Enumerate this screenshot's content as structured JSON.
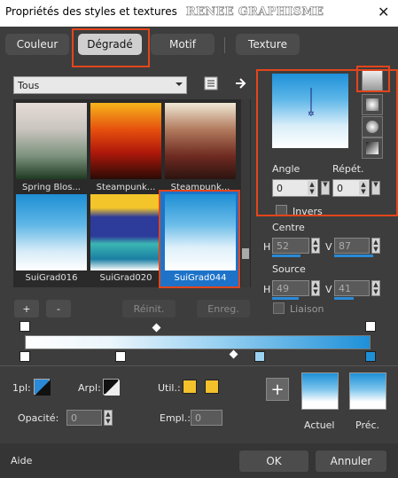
{
  "window": {
    "title": "Propriétés des styles et textures",
    "watermark": "RENEE GRAPHISME",
    "close": "✕"
  },
  "tabs": [
    {
      "label": "Couleur",
      "active": false
    },
    {
      "label": "Dégradé",
      "active": true
    },
    {
      "label": "Motif",
      "active": false
    },
    {
      "label": "Texture",
      "active": false
    }
  ],
  "category": {
    "selected": "Tous"
  },
  "swatches": [
    {
      "label": "Spring Blos...",
      "colors": [
        "#e6dcd8",
        "#9aa79a",
        "#1f3a22"
      ]
    },
    {
      "label": "Steampunk...",
      "colors": [
        "#f4a41b",
        "#c02a0a",
        "#2a0b05"
      ]
    },
    {
      "label": "Steampunk...",
      "colors": [
        "#f0e8d5",
        "#7a3527",
        "#2c1410"
      ]
    },
    {
      "label": "SuiGrad016",
      "colors": [
        "#1e8fd4",
        "#8fcbef",
        "#ffffff"
      ]
    },
    {
      "label": "SuiGrad020",
      "colors": [
        "#f3c52a",
        "#2d3b9b",
        "#36b3b0"
      ]
    },
    {
      "label": "SuiGrad044",
      "colors": [
        "#1e8fd4",
        "#d9eef9",
        "#ffffff"
      ],
      "selected": true
    }
  ],
  "buttons": {
    "add": "+",
    "remove": "-",
    "reset": "Réinit.",
    "save": "Enreg."
  },
  "preview": {
    "top_color": "#1e90d8",
    "bottom_color": "#ffffff"
  },
  "angle": {
    "label": "Angle",
    "value": "0"
  },
  "repeat": {
    "label": "Répét.",
    "value": "0"
  },
  "invert": {
    "label": "Invers",
    "checked": false
  },
  "center": {
    "label": "Centre",
    "h_label": "H",
    "h_value": "52",
    "v_label": "V",
    "v_value": "87"
  },
  "source": {
    "label": "Source",
    "h_label": "H",
    "h_value": "49",
    "v_label": "V",
    "v_value": "41"
  },
  "link": {
    "label": "Liaison"
  },
  "gradient_bar": {
    "start_color": "#ffffff",
    "end_color": "#1e90d8"
  },
  "bottom": {
    "pl_label": "1pl:",
    "arpl_label": "Arpl:",
    "util_label": "Util.:",
    "opacity_label": "Opacité:",
    "opacity_value": "0",
    "empl_label": "Empl.:",
    "empl_value": "0",
    "util_color": "#f2c12b"
  },
  "actual": {
    "label": "Actuel"
  },
  "previous": {
    "label": "Préc."
  },
  "footer": {
    "help": "Aide",
    "ok": "OK",
    "cancel": "Annuler"
  },
  "accent_colors": {
    "highlight": "#e4451b",
    "selection": "#1e73c8"
  }
}
